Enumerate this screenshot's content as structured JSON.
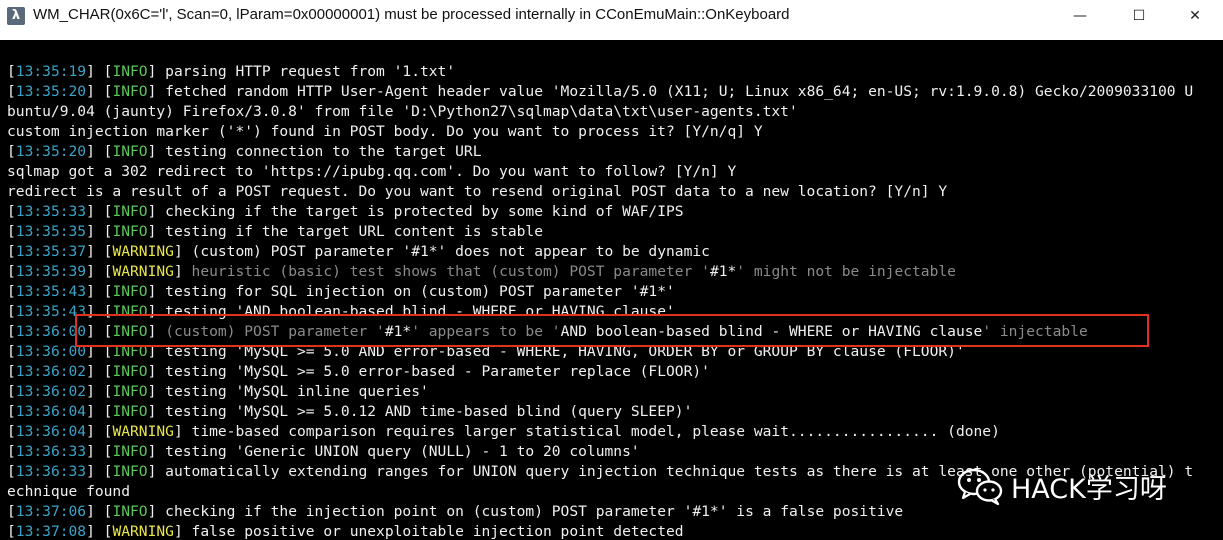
{
  "window": {
    "title": "WM_CHAR(0x6C='l', Scan=0, lParam=0x00000001) must be processed internally in CConEmuMain::OnKeyboard",
    "app_icon_glyph": "λ",
    "minimize_glyph": "—",
    "maximize_glyph": "☐",
    "close_glyph": "✕"
  },
  "colors": {
    "background": "#000000",
    "text": "#f0f0f0",
    "timestamp": "#3aa3c8",
    "info": "#58c858",
    "warning": "#e8e64a",
    "dim": "#8a8a8a",
    "highlight_box": "#e0301e"
  },
  "terminal": {
    "lines": [
      [
        {
          "t": "[",
          "c": "text"
        },
        {
          "t": "13:35:19",
          "c": "timestamp"
        },
        {
          "t": "] [",
          "c": "text"
        },
        {
          "t": "INFO",
          "c": "info"
        },
        {
          "t": "] parsing HTTP request from '1.txt'",
          "c": "text"
        }
      ],
      [
        {
          "t": "[",
          "c": "text"
        },
        {
          "t": "13:35:20",
          "c": "timestamp"
        },
        {
          "t": "] [",
          "c": "text"
        },
        {
          "t": "INFO",
          "c": "info"
        },
        {
          "t": "] fetched random HTTP User-Agent header value 'Mozilla/5.0 (X11; U; Linux x86_64; en-US; rv:1.9.0.8) Gecko/2009033100 U",
          "c": "text"
        }
      ],
      [
        {
          "t": "buntu/9.04 (jaunty) Firefox/3.0.8' from file 'D:\\Python27\\sqlmap\\data\\txt\\user-agents.txt'",
          "c": "text"
        }
      ],
      [
        {
          "t": "custom injection marker ('*') found in POST body. Do you want to process it? [Y/n/q] Y",
          "c": "text"
        }
      ],
      [
        {
          "t": "[",
          "c": "text"
        },
        {
          "t": "13:35:20",
          "c": "timestamp"
        },
        {
          "t": "] [",
          "c": "text"
        },
        {
          "t": "INFO",
          "c": "info"
        },
        {
          "t": "] testing connection to the target URL",
          "c": "text"
        }
      ],
      [
        {
          "t": "sqlmap got a 302 redirect to 'https://ipubg.qq.com'. Do you want to follow? [Y/n] Y",
          "c": "text"
        }
      ],
      [
        {
          "t": "redirect is a result of a POST request. Do you want to resend original POST data to a new location? [Y/n] Y",
          "c": "text"
        }
      ],
      [
        {
          "t": "[",
          "c": "text"
        },
        {
          "t": "13:35:33",
          "c": "timestamp"
        },
        {
          "t": "] [",
          "c": "text"
        },
        {
          "t": "INFO",
          "c": "info"
        },
        {
          "t": "] checking if the target is protected by some kind of WAF/IPS",
          "c": "text"
        }
      ],
      [
        {
          "t": "[",
          "c": "text"
        },
        {
          "t": "13:35:35",
          "c": "timestamp"
        },
        {
          "t": "] [",
          "c": "text"
        },
        {
          "t": "INFO",
          "c": "info"
        },
        {
          "t": "] testing if the target URL content is stable",
          "c": "text"
        }
      ],
      [
        {
          "t": "[",
          "c": "text"
        },
        {
          "t": "13:35:37",
          "c": "timestamp"
        },
        {
          "t": "] [",
          "c": "text"
        },
        {
          "t": "WARNING",
          "c": "warning"
        },
        {
          "t": "] (custom) POST parameter '#1*' does not appear to be dynamic",
          "c": "text"
        }
      ],
      [
        {
          "t": "[",
          "c": "text"
        },
        {
          "t": "13:35:39",
          "c": "timestamp"
        },
        {
          "t": "] [",
          "c": "text"
        },
        {
          "t": "WARNING",
          "c": "warning"
        },
        {
          "t": "] ",
          "c": "text"
        },
        {
          "t": "heuristic (basic) test shows that (custom) POST parameter '",
          "c": "dim"
        },
        {
          "t": "#1*",
          "c": "text"
        },
        {
          "t": "' might not be injectable",
          "c": "dim"
        }
      ],
      [
        {
          "t": "[",
          "c": "text"
        },
        {
          "t": "13:35:43",
          "c": "timestamp"
        },
        {
          "t": "] [",
          "c": "text"
        },
        {
          "t": "INFO",
          "c": "info"
        },
        {
          "t": "] testing for SQL injection on (custom) POST parameter '#1*'",
          "c": "text"
        }
      ],
      [
        {
          "t": "[",
          "c": "text"
        },
        {
          "t": "13:35:43",
          "c": "timestamp"
        },
        {
          "t": "] [",
          "c": "text"
        },
        {
          "t": "INFO",
          "c": "info"
        },
        {
          "t": "] testing 'AND boolean-based blind - WHERE or HAVING clause'",
          "c": "text"
        }
      ],
      [
        {
          "t": "[",
          "c": "text"
        },
        {
          "t": "13:36:00",
          "c": "timestamp"
        },
        {
          "t": "] [",
          "c": "text"
        },
        {
          "t": "INFO",
          "c": "info"
        },
        {
          "t": "] ",
          "c": "text"
        },
        {
          "t": "(custom) POST parameter '",
          "c": "dim"
        },
        {
          "t": "#1*",
          "c": "text"
        },
        {
          "t": "' appears to be '",
          "c": "dim"
        },
        {
          "t": "AND boolean-based blind - WHERE or HAVING clause",
          "c": "text"
        },
        {
          "t": "' injectable",
          "c": "dim"
        }
      ],
      [
        {
          "t": "[",
          "c": "text"
        },
        {
          "t": "13:36:00",
          "c": "timestamp"
        },
        {
          "t": "] [",
          "c": "text"
        },
        {
          "t": "INFO",
          "c": "info"
        },
        {
          "t": "] testing 'MySQL >= 5.0 AND error-based - WHERE, HAVING, ORDER BY or GROUP BY clause (FLOOR)'",
          "c": "text"
        }
      ],
      [
        {
          "t": "[",
          "c": "text"
        },
        {
          "t": "13:36:02",
          "c": "timestamp"
        },
        {
          "t": "] [",
          "c": "text"
        },
        {
          "t": "INFO",
          "c": "info"
        },
        {
          "t": "] testing 'MySQL >= 5.0 error-based - Parameter replace (FLOOR)'",
          "c": "text"
        }
      ],
      [
        {
          "t": "[",
          "c": "text"
        },
        {
          "t": "13:36:02",
          "c": "timestamp"
        },
        {
          "t": "] [",
          "c": "text"
        },
        {
          "t": "INFO",
          "c": "info"
        },
        {
          "t": "] testing 'MySQL inline queries'",
          "c": "text"
        }
      ],
      [
        {
          "t": "[",
          "c": "text"
        },
        {
          "t": "13:36:04",
          "c": "timestamp"
        },
        {
          "t": "] [",
          "c": "text"
        },
        {
          "t": "INFO",
          "c": "info"
        },
        {
          "t": "] testing 'MySQL >= 5.0.12 AND time-based blind (query SLEEP)'",
          "c": "text"
        }
      ],
      [
        {
          "t": "[",
          "c": "text"
        },
        {
          "t": "13:36:04",
          "c": "timestamp"
        },
        {
          "t": "] [",
          "c": "text"
        },
        {
          "t": "WARNING",
          "c": "warning"
        },
        {
          "t": "] time-based comparison requires larger statistical model, please wait................. (done)",
          "c": "text"
        }
      ],
      [
        {
          "t": "[",
          "c": "text"
        },
        {
          "t": "13:36:33",
          "c": "timestamp"
        },
        {
          "t": "] [",
          "c": "text"
        },
        {
          "t": "INFO",
          "c": "info"
        },
        {
          "t": "] testing 'Generic UNION query (NULL) - 1 to 20 columns'",
          "c": "text"
        }
      ],
      [
        {
          "t": "[",
          "c": "text"
        },
        {
          "t": "13:36:33",
          "c": "timestamp"
        },
        {
          "t": "] [",
          "c": "text"
        },
        {
          "t": "INFO",
          "c": "info"
        },
        {
          "t": "] automatically extending ranges for UNION query injection technique tests as there is at least one other (potential) t",
          "c": "text"
        }
      ],
      [
        {
          "t": "echnique found",
          "c": "text"
        }
      ],
      [
        {
          "t": "[",
          "c": "text"
        },
        {
          "t": "13:37:06",
          "c": "timestamp"
        },
        {
          "t": "] [",
          "c": "text"
        },
        {
          "t": "INFO",
          "c": "info"
        },
        {
          "t": "] checking if the injection point on (custom) POST parameter '#1*' is a false positive",
          "c": "text"
        }
      ],
      [
        {
          "t": "[",
          "c": "text"
        },
        {
          "t": "13:37:08",
          "c": "timestamp"
        },
        {
          "t": "] [",
          "c": "text"
        },
        {
          "t": "WARNING",
          "c": "warning"
        },
        {
          "t": "] false positive or unexploitable injection point detected",
          "c": "text"
        }
      ]
    ]
  },
  "watermark": {
    "text": "HACK学习呀",
    "icon": "wechat-logo-icon"
  }
}
